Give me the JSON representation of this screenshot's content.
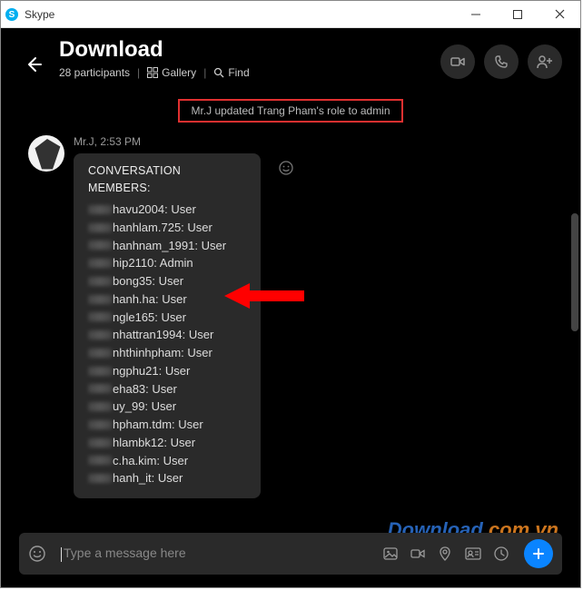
{
  "titlebar": {
    "app_name": "Skype"
  },
  "header": {
    "title": "Download",
    "participants": "28 participants",
    "gallery_label": "Gallery",
    "find_label": "Find"
  },
  "system_notice": "Mr.J updated Trang Pham's role to admin",
  "message": {
    "sender": "Mr.J",
    "time": "2:53 PM",
    "title": "CONVERSATION MEMBERS:",
    "members": [
      {
        "obscured": "",
        "clear": "havu2004: User"
      },
      {
        "obscured": "",
        "clear": "hanhlam.725: User"
      },
      {
        "obscured": "",
        "clear": "hanhnam_1991: User"
      },
      {
        "obscured": "",
        "clear": "hip2110: Admin"
      },
      {
        "obscured": "",
        "clear": "bong35: User"
      },
      {
        "obscured": "",
        "clear": "hanh.ha: User"
      },
      {
        "obscured": "",
        "clear": "ngle165: User"
      },
      {
        "obscured": "",
        "clear": "nhattran1994: User"
      },
      {
        "obscured": "",
        "clear": "nhthinhpham: User"
      },
      {
        "obscured": "",
        "clear": "ngphu21: User"
      },
      {
        "obscured": "",
        "clear": "eha83: User"
      },
      {
        "obscured": "",
        "clear": "uy_99: User"
      },
      {
        "obscured": "",
        "clear": "hpham.tdm: User"
      },
      {
        "obscured": "",
        "clear": "hlambk12: User"
      },
      {
        "obscured": "",
        "clear": "c.ha.kim: User"
      },
      {
        "obscured": "",
        "clear": "hanh_it: User"
      }
    ]
  },
  "composer": {
    "placeholder": "Type a message here"
  },
  "watermark": {
    "part1": "Download",
    "part2": ".com.vn"
  }
}
